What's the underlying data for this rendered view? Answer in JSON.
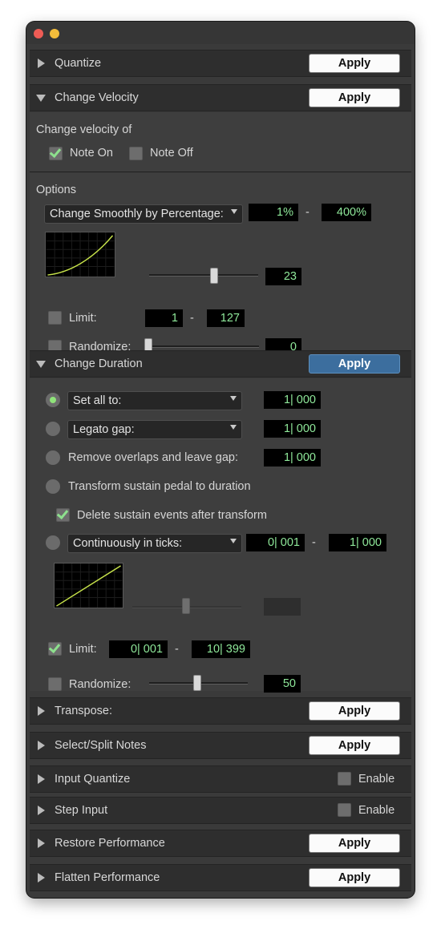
{
  "colors": {
    "accent_green": "#8fe89a",
    "apply_active": "#3c6e9e"
  },
  "quantize": {
    "label": "Quantize",
    "apply": "Apply"
  },
  "change_velocity": {
    "label": "Change Velocity",
    "apply": "Apply",
    "change_velocity_of": "Change velocity of",
    "note_on": {
      "label": "Note On",
      "checked": true
    },
    "note_off": {
      "label": "Note Off",
      "checked": false
    },
    "options_label": "Options",
    "mode": "Change Smoothly by Percentage:",
    "min_pct": "1%",
    "range_dash": "-",
    "max_pct": "400%",
    "curve_value": "23",
    "limit": {
      "label": "Limit:",
      "checked": false,
      "min": "1",
      "dash": "-",
      "max": "127"
    },
    "randomize": {
      "label": "Randomize:",
      "checked": false,
      "value": "0"
    }
  },
  "change_duration": {
    "label": "Change Duration",
    "apply": "Apply",
    "set_all_to": {
      "label": "Set all to:",
      "value": "1| 000",
      "selected": true
    },
    "legato_gap": {
      "label": "Legato gap:",
      "value": "1| 000"
    },
    "remove_overlaps": {
      "label": "Remove overlaps and leave gap:",
      "value": "1| 000"
    },
    "sustain_pedal": {
      "label": "Transform sustain pedal to duration"
    },
    "delete_sustain": {
      "label": "Delete sustain events after transform",
      "checked": true
    },
    "continuously": {
      "label": "Continuously in ticks:",
      "min": "0| 001",
      "dash": "-",
      "max": "1| 000"
    },
    "limit": {
      "label": "Limit:",
      "checked": true,
      "min": "0| 001",
      "dash": "-",
      "max": "10| 399"
    },
    "randomize": {
      "label": "Randomize:",
      "checked": false,
      "value": "50"
    }
  },
  "transpose": {
    "label": "Transpose:",
    "apply": "Apply"
  },
  "select_split": {
    "label": "Select/Split Notes",
    "apply": "Apply"
  },
  "input_quantize": {
    "label": "Input Quantize",
    "enable": "Enable"
  },
  "step_input": {
    "label": "Step Input",
    "enable": "Enable"
  },
  "restore_performance": {
    "label": "Restore Performance",
    "apply": "Apply"
  },
  "flatten_performance": {
    "label": "Flatten Performance",
    "apply": "Apply"
  }
}
